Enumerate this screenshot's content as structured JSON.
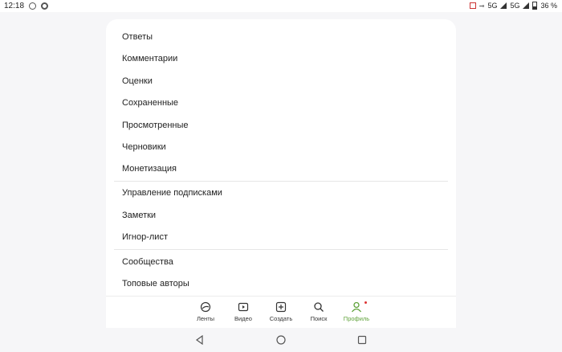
{
  "status_bar": {
    "time": "12:18",
    "network": "5G",
    "network2": "5G",
    "battery": "36 %"
  },
  "menu": {
    "items": [
      {
        "label": "Ответы"
      },
      {
        "label": "Комментарии"
      },
      {
        "label": "Оценки"
      },
      {
        "label": "Сохраненные"
      },
      {
        "label": "Просмотренные"
      },
      {
        "label": "Черновики"
      },
      {
        "label": "Монетизация"
      },
      {
        "label": "Управление подписками"
      },
      {
        "label": "Заметки"
      },
      {
        "label": "Игнор-лист"
      },
      {
        "label": "Сообщества"
      },
      {
        "label": "Топовые авторы"
      }
    ]
  },
  "bottom_nav": {
    "items": [
      {
        "label": "Ленты",
        "icon": "feeds-icon"
      },
      {
        "label": "Видео",
        "icon": "video-icon"
      },
      {
        "label": "Создать",
        "icon": "create-icon"
      },
      {
        "label": "Поиск",
        "icon": "search-icon"
      },
      {
        "label": "Профиль",
        "icon": "profile-icon",
        "active": true
      }
    ],
    "accent": "#5fa23a"
  }
}
